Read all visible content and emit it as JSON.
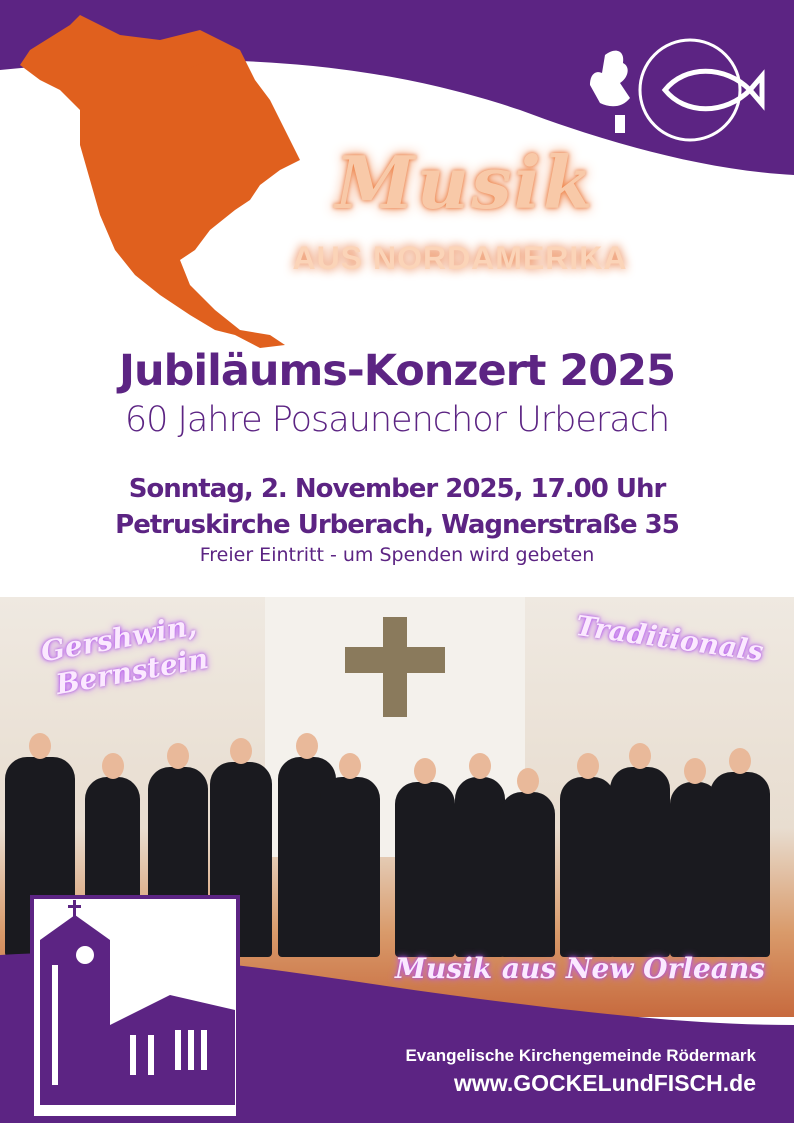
{
  "colors": {
    "brand_purple": "#5c2483",
    "map_orange": "#e0601e"
  },
  "header": {
    "logo": "Gockel und Fisch rooster-fish logo",
    "headline_script": "Musik",
    "headline_sub": "AUS NORDAMERIKA"
  },
  "event": {
    "title": "Jubiläums-Konzert 2025",
    "subtitle": "60 Jahre Posaunenchor Urberach",
    "date_time": "Sonntag, 2. November 2025, 17.00 Uhr",
    "location": "Petruskirche Urberach, Wagnerstraße 35",
    "admission": "Freier Eintritt - um Spenden wird gebeten"
  },
  "photo": {
    "labels": [
      "Gershwin,",
      "Bernstein",
      "Traditionals",
      "Musik aus New Orleans"
    ]
  },
  "footer": {
    "organization": "Evangelische Kirchengemeinde Rödermark",
    "website": "www.GOCKELundFISCH.de",
    "icon": "church-icon"
  }
}
